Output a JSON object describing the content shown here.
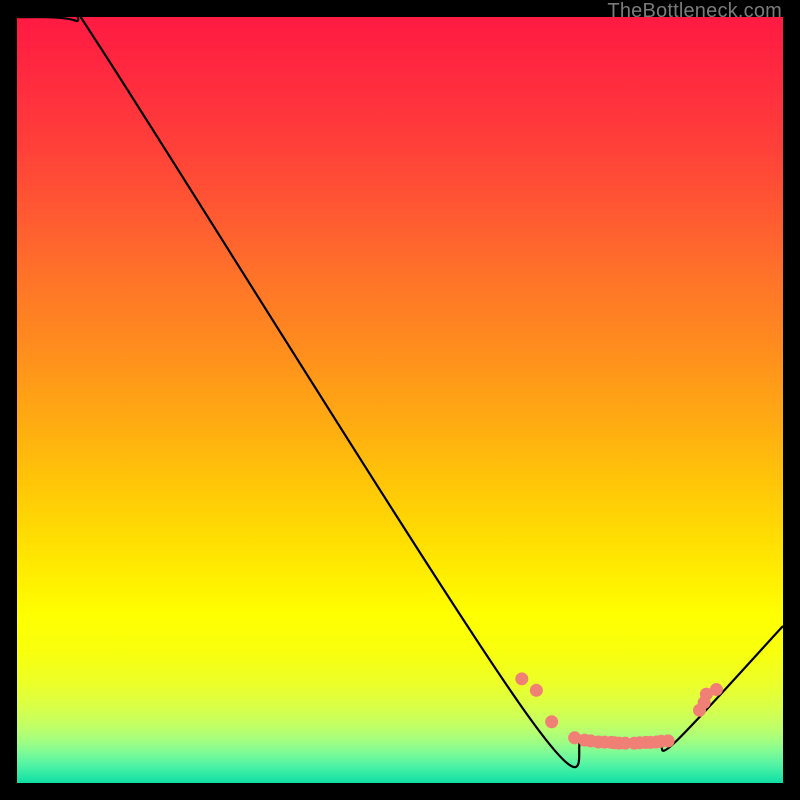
{
  "watermark": "TheBottleneck.com",
  "chart_data": {
    "type": "line",
    "title": "",
    "xlabel": "",
    "ylabel": "",
    "xlim": [
      0,
      100
    ],
    "ylim": [
      0,
      100
    ],
    "grid": false,
    "series": [
      {
        "name": "curve",
        "x": [
          0,
          7.7,
          10.9,
          65.5,
          74,
          77,
          80,
          83,
          84,
          86.2,
          100
        ],
        "y": [
          100,
          99.5,
          96,
          10.5,
          5.7,
          5,
          4.8,
          5,
          5,
          5.6,
          20.5
        ]
      }
    ],
    "markers": {
      "name": "dots",
      "color": "#f08075",
      "points": [
        {
          "x": 65.9,
          "y": 13.6
        },
        {
          "x": 67.8,
          "y": 12.1
        },
        {
          "x": 69.8,
          "y": 8.0
        },
        {
          "x": 72.8,
          "y": 5.9
        },
        {
          "x": 74.1,
          "y": 5.6
        },
        {
          "x": 74.9,
          "y": 5.5
        },
        {
          "x": 75.9,
          "y": 5.35
        },
        {
          "x": 76.7,
          "y": 5.33
        },
        {
          "x": 77.6,
          "y": 5.3
        },
        {
          "x": 78.0,
          "y": 5.25
        },
        {
          "x": 78.6,
          "y": 5.2
        },
        {
          "x": 79.4,
          "y": 5.2
        },
        {
          "x": 80.6,
          "y": 5.2
        },
        {
          "x": 81.3,
          "y": 5.25
        },
        {
          "x": 82.1,
          "y": 5.3
        },
        {
          "x": 82.7,
          "y": 5.3
        },
        {
          "x": 83.5,
          "y": 5.35
        },
        {
          "x": 84.1,
          "y": 5.45
        },
        {
          "x": 85.0,
          "y": 5.5
        },
        {
          "x": 89.1,
          "y": 9.5
        },
        {
          "x": 89.7,
          "y": 10.5
        },
        {
          "x": 90.0,
          "y": 11.6
        },
        {
          "x": 91.3,
          "y": 12.2
        }
      ]
    },
    "background": {
      "type": "vertical-gradient",
      "stops": [
        {
          "pos": 0.0,
          "color": "#ff1a42"
        },
        {
          "pos": 0.08,
          "color": "#ff2b3f"
        },
        {
          "pos": 0.17,
          "color": "#ff4039"
        },
        {
          "pos": 0.26,
          "color": "#ff5a32"
        },
        {
          "pos": 0.34,
          "color": "#ff7329"
        },
        {
          "pos": 0.43,
          "color": "#ff8c1e"
        },
        {
          "pos": 0.52,
          "color": "#ffa813"
        },
        {
          "pos": 0.6,
          "color": "#ffc309"
        },
        {
          "pos": 0.67,
          "color": "#ffda03"
        },
        {
          "pos": 0.73,
          "color": "#ffee00"
        },
        {
          "pos": 0.78,
          "color": "#ffff00"
        },
        {
          "pos": 0.83,
          "color": "#f8ff0e"
        },
        {
          "pos": 0.87,
          "color": "#ecff29"
        },
        {
          "pos": 0.9,
          "color": "#daff47"
        },
        {
          "pos": 0.925,
          "color": "#c1ff65"
        },
        {
          "pos": 0.945,
          "color": "#a2fe81"
        },
        {
          "pos": 0.96,
          "color": "#7efb96"
        },
        {
          "pos": 0.975,
          "color": "#55f4a3"
        },
        {
          "pos": 0.99,
          "color": "#2be8a6"
        },
        {
          "pos": 1.0,
          "color": "#0fdea4"
        }
      ]
    }
  }
}
